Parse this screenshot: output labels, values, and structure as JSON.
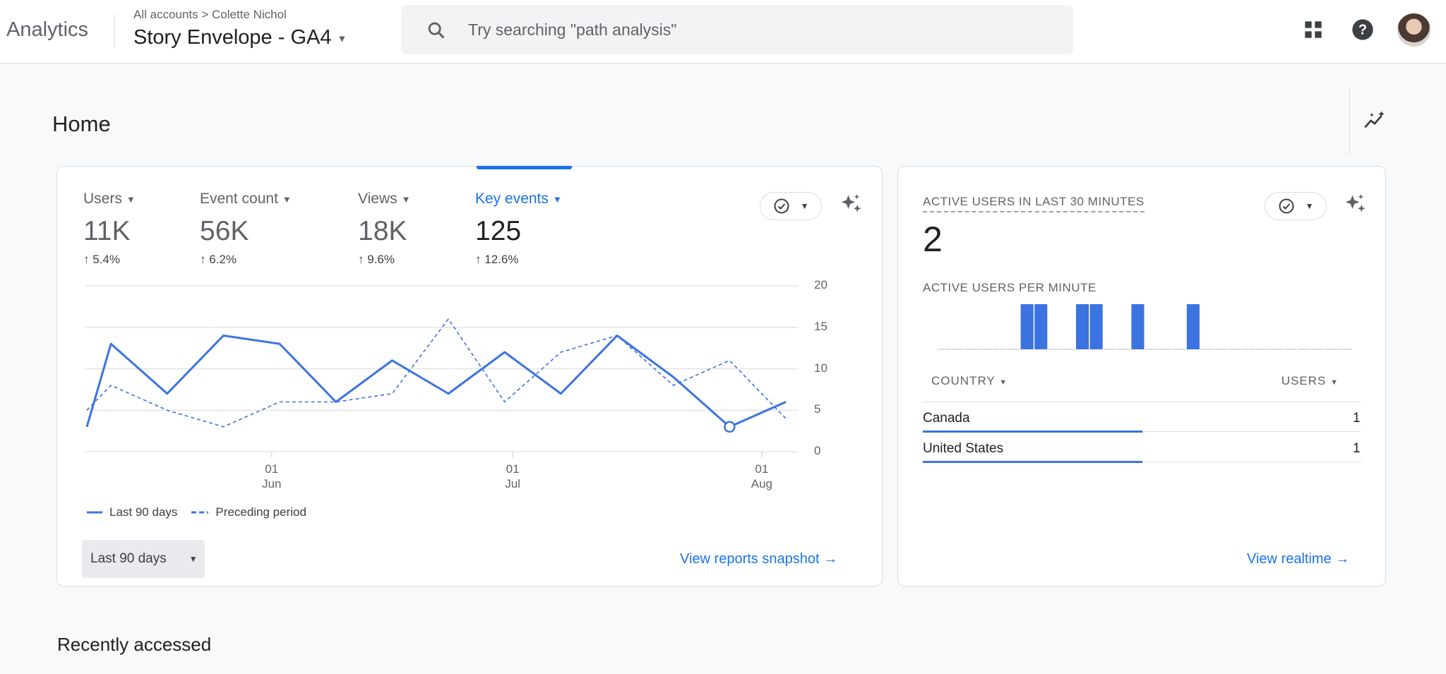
{
  "header": {
    "brand": "Analytics",
    "breadcrumb": "All accounts > Colette Nichol",
    "property": "Story Envelope - GA4",
    "search_placeholder": "Try searching \"path analysis\"",
    "icons": [
      "search-icon",
      "apps-grid-icon",
      "help-icon",
      "avatar"
    ]
  },
  "page": {
    "title": "Home",
    "recently_accessed": "Recently accessed"
  },
  "overview_card": {
    "metrics": [
      {
        "label": "Users",
        "value": "11K",
        "delta": "5.4%",
        "active": false
      },
      {
        "label": "Event count",
        "value": "56K",
        "delta": "6.2%",
        "active": false
      },
      {
        "label": "Views",
        "value": "18K",
        "delta": "9.6%",
        "active": false
      },
      {
        "label": "Key events",
        "value": "125",
        "delta": "12.6%",
        "active": true
      }
    ],
    "date_range": "Last 90 days",
    "link": "View reports snapshot",
    "accent": "#1a73e8"
  },
  "chart_data": [
    {
      "type": "line",
      "x": [
        "May 9",
        "May 12",
        "May 19",
        "May 26",
        "Jun 2",
        "Jun 9",
        "Jun 16",
        "Jun 23",
        "Jun 30",
        "Jul 7",
        "Jul 14",
        "Jul 21",
        "Jul 28",
        "Aug 4"
      ],
      "series": [
        {
          "name": "Last 90 days",
          "style": "solid",
          "values": [
            3,
            13,
            7,
            14,
            13,
            6,
            11,
            7,
            12,
            7,
            14,
            9,
            3,
            6
          ]
        },
        {
          "name": "Preceding period",
          "style": "dashed",
          "values": [
            5,
            8,
            5,
            3,
            6,
            6,
            7,
            16,
            6,
            12,
            14,
            8,
            11,
            4
          ]
        }
      ],
      "ylim": [
        0,
        20
      ],
      "yticks": [
        "20",
        "15",
        "10",
        "5",
        "0"
      ],
      "xticks": [
        {
          "day": "01",
          "month": "Jun"
        },
        {
          "day": "01",
          "month": "Jul"
        },
        {
          "day": "01",
          "month": "Aug"
        }
      ],
      "y_axis_side": "right",
      "grid": true,
      "legend": "bottom-left",
      "color": "#3b73e0"
    },
    {
      "type": "bar",
      "title": "ACTIVE USERS PER MINUTE",
      "values": [
        0,
        0,
        0,
        0,
        0,
        0,
        1,
        1,
        0,
        0,
        1,
        1,
        0,
        0,
        1,
        0,
        0,
        0,
        1,
        0,
        0,
        0,
        0,
        0,
        0,
        0,
        0,
        0,
        0,
        0
      ],
      "color": "#3b73e0"
    }
  ],
  "realtime_card": {
    "title": "ACTIVE USERS IN LAST 30 MINUTES",
    "value": "2",
    "per_minute_label": "ACTIVE USERS PER MINUTE",
    "col_country": "COUNTRY",
    "col_users": "USERS",
    "rows": [
      {
        "country": "Canada",
        "users": "1",
        "share": 1.0
      },
      {
        "country": "United States",
        "users": "1",
        "share": 1.0
      }
    ],
    "link": "View realtime"
  }
}
